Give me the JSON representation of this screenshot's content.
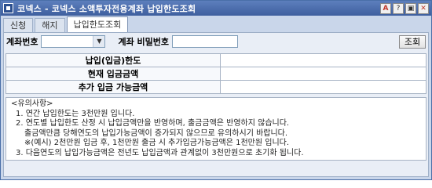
{
  "window": {
    "title": "코넥스 - 코넥스 소액투자전용계좌 납입한도조회",
    "buttons": [
      "A",
      "?",
      "▣",
      "✕"
    ]
  },
  "tabs": [
    {
      "label": "신청",
      "active": false
    },
    {
      "label": "해지",
      "active": false
    },
    {
      "label": "납입한도조회",
      "active": true
    }
  ],
  "form": {
    "account_label": "계좌번호",
    "account_value": "",
    "password_label": "계좌 비밀번호",
    "password_value": "",
    "query_button": "조회"
  },
  "info": [
    {
      "label": "납입(입금)한도",
      "value": ""
    },
    {
      "label": "현재 입금금액",
      "value": ""
    },
    {
      "label": "추가 입금 가능금액",
      "value": ""
    }
  ],
  "notes": {
    "header": "<유의사항>",
    "lines": [
      "1. 연간 납입한도는 3천만원 입니다.",
      "2. 연도별 납입한도 산정 시 납입금액만을 반영하며, 출금금액은 반영하지 않습니다.",
      "출금액만큼 당해연도의 납입가능금액이 증가되지 않으므로 유의하시기 바랍니다.",
      "※(예시) 2천만원 입금 후, 1천만원 출금 시 추가입금가능금액은 1천만원 입니다.",
      "3. 다음연도의 납입가능금액은 전년도 납입금액과 관계없이 3천만원으로 초기화 됩니다."
    ]
  }
}
